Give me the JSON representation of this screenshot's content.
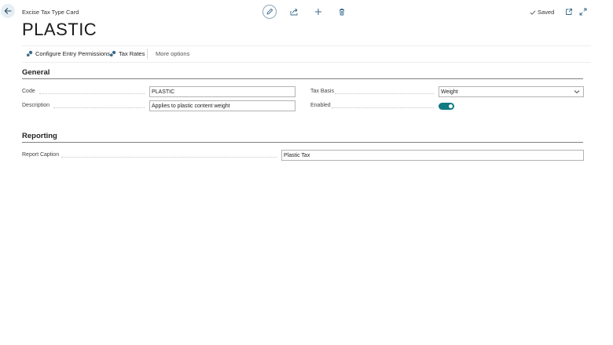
{
  "header": {
    "page_caption": "Excise Tax Type Card",
    "saved_label": "Saved",
    "record_title": "PLASTIC"
  },
  "actions": {
    "configure_permissions": "Configure Entry Permissions",
    "tax_rates": "Tax Rates",
    "more_options": "More options"
  },
  "general": {
    "section_title": "General",
    "code_label": "Code",
    "code_value": "PLASTIC",
    "description_label": "Description",
    "description_value": "Applies to plastic content weight",
    "tax_basis_label": "Tax Basis",
    "tax_basis_value": "Weight",
    "enabled_label": "Enabled",
    "enabled_value": true
  },
  "reporting": {
    "section_title": "Reporting",
    "report_caption_label": "Report Caption",
    "report_caption_value": "Plastic Tax"
  },
  "colors": {
    "accent": "#0f7b83",
    "toolbar_icon": "#3a6a8a"
  }
}
